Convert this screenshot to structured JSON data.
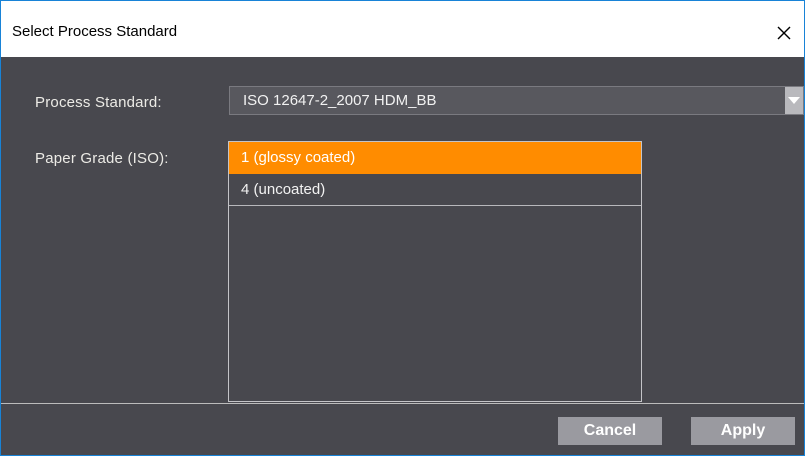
{
  "window": {
    "title": "Select Process Standard"
  },
  "form": {
    "process_standard_label": "Process Standard:",
    "process_standard_value": "ISO 12647-2_2007 HDM_BB",
    "paper_grade_label": "Paper Grade (ISO):",
    "paper_grades": [
      {
        "label": "1 (glossy coated)",
        "selected": true
      },
      {
        "label": "4 (uncoated)",
        "selected": false
      }
    ]
  },
  "footer": {
    "cancel_label": "Cancel",
    "apply_label": "Apply"
  },
  "colors": {
    "background": "#48484e",
    "selection": "#ff8c00",
    "button": "#9a9aa0",
    "window_border": "#1883d7"
  },
  "icons": {
    "close": "close-icon",
    "dropdown": "chevron-down-icon"
  }
}
